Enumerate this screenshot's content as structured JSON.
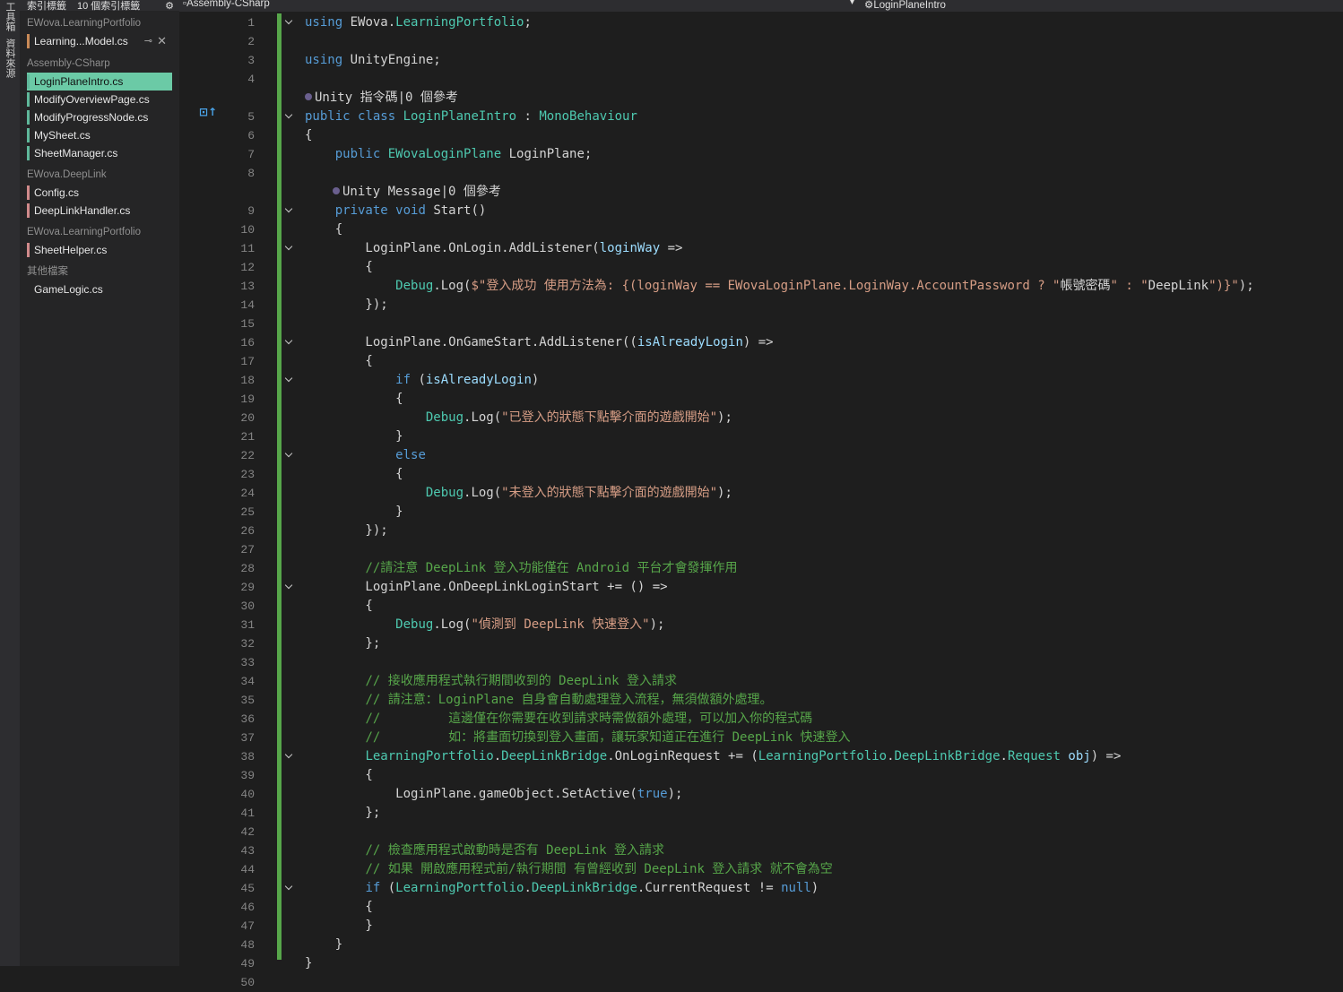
{
  "panel": {
    "header_left": "索引標籤",
    "header_count": "10 個索引標籤",
    "vertical_tabs": [
      "工具箱",
      "資料來源"
    ],
    "groups": [
      {
        "name": "EWova.LearningPortfolio",
        "color": "orange",
        "files": [
          {
            "name": "Learning...Model.cs",
            "pinned": true,
            "closable": true
          }
        ]
      },
      {
        "name": "Assembly-CSharp",
        "color": "green",
        "files": [
          {
            "name": "LoginPlaneIntro.cs",
            "selected": true
          },
          {
            "name": "ModifyOverviewPage.cs"
          },
          {
            "name": "ModifyProgressNode.cs"
          },
          {
            "name": "MySheet.cs"
          },
          {
            "name": "SheetManager.cs"
          }
        ]
      },
      {
        "name": "EWova.DeepLink",
        "color": "pink",
        "files": [
          {
            "name": "Config.cs"
          },
          {
            "name": "DeepLinkHandler.cs"
          }
        ]
      },
      {
        "name": "EWova.LearningPortfolio",
        "color": "pink",
        "files": [
          {
            "name": "SheetHelper.cs"
          }
        ]
      },
      {
        "name": "其他檔案",
        "color": "none",
        "files": [
          {
            "name": "GameLogic.cs"
          }
        ]
      }
    ]
  },
  "navbar": {
    "project": "Assembly-CSharp",
    "member": "LoginPlaneIntro"
  },
  "codelens": {
    "class_refs": "Unity 指令碼|0 個參考",
    "method_refs": "Unity Message|0 個參考"
  },
  "code_lines": [
    {
      "n": 1,
      "text": "using EWova.LearningPortfolio;",
      "fold": true
    },
    {
      "n": 2,
      "text": ""
    },
    {
      "n": 3,
      "text": "using UnityEngine;"
    },
    {
      "n": 4,
      "text": ""
    },
    {
      "n": 5,
      "text": "public class LoginPlaneIntro : MonoBehaviour",
      "fold": true,
      "lens": "class"
    },
    {
      "n": 6,
      "text": "{"
    },
    {
      "n": 7,
      "text": "    public EWovaLoginPlane LoginPlane;"
    },
    {
      "n": 8,
      "text": ""
    },
    {
      "n": 9,
      "text": "    private void Start()",
      "fold": true,
      "lens": "method"
    },
    {
      "n": 10,
      "text": "    {"
    },
    {
      "n": 11,
      "text": "        LoginPlane.OnLogin.AddListener(loginWay =>",
      "fold": true
    },
    {
      "n": 12,
      "text": "        {"
    },
    {
      "n": 13,
      "text": "            Debug.Log($\"登入成功 使用方法為: {(loginWay == EWovaLoginPlane.LoginWay.AccountPassword ? \"帳號密碼\" : \"DeepLink\")}\");"
    },
    {
      "n": 14,
      "text": "        });"
    },
    {
      "n": 15,
      "text": ""
    },
    {
      "n": 16,
      "text": "        LoginPlane.OnGameStart.AddListener((isAlreadyLogin) =>",
      "fold": true
    },
    {
      "n": 17,
      "text": "        {"
    },
    {
      "n": 18,
      "text": "            if (isAlreadyLogin)",
      "fold": true
    },
    {
      "n": 19,
      "text": "            {"
    },
    {
      "n": 20,
      "text": "                Debug.Log(\"已登入的狀態下點擊介面的遊戲開始\");"
    },
    {
      "n": 21,
      "text": "            }"
    },
    {
      "n": 22,
      "text": "            else",
      "fold": true
    },
    {
      "n": 23,
      "text": "            {"
    },
    {
      "n": 24,
      "text": "                Debug.Log(\"未登入的狀態下點擊介面的遊戲開始\");"
    },
    {
      "n": 25,
      "text": "            }"
    },
    {
      "n": 26,
      "text": "        });"
    },
    {
      "n": 27,
      "text": ""
    },
    {
      "n": 28,
      "text": "        //請注意 DeepLink 登入功能僅在 Android 平台才會發揮作用"
    },
    {
      "n": 29,
      "text": "        LoginPlane.OnDeepLinkLoginStart += () =>",
      "fold": true
    },
    {
      "n": 30,
      "text": "        {"
    },
    {
      "n": 31,
      "text": "            Debug.Log(\"偵測到 DeepLink 快速登入\");"
    },
    {
      "n": 32,
      "text": "        };"
    },
    {
      "n": 33,
      "text": ""
    },
    {
      "n": 34,
      "text": "        // 接收應用程式執行期間收到的 DeepLink 登入請求"
    },
    {
      "n": 35,
      "text": "        // 請注意：LoginPlane 自身會自動處理登入流程，無須做額外處理。"
    },
    {
      "n": 36,
      "text": "        //         這邊僅在你需要在收到請求時需做額外處理，可以加入你的程式碼"
    },
    {
      "n": 37,
      "text": "        //         如：將畫面切換到登入畫面，讓玩家知道正在進行 DeepLink 快速登入"
    },
    {
      "n": 38,
      "text": "        LearningPortfolio.DeepLinkBridge.OnLoginRequest += (LearningPortfolio.DeepLinkBridge.Request obj) =>",
      "fold": true
    },
    {
      "n": 39,
      "text": "        {"
    },
    {
      "n": 40,
      "text": "            LoginPlane.gameObject.SetActive(true);"
    },
    {
      "n": 41,
      "text": "        };"
    },
    {
      "n": 42,
      "text": ""
    },
    {
      "n": 43,
      "text": "        // 檢查應用程式啟動時是否有 DeepLink 登入請求"
    },
    {
      "n": 44,
      "text": "        // 如果 開啟應用程式前/執行期間 有曾經收到 DeepLink 登入請求 就不會為空"
    },
    {
      "n": 45,
      "text": "        if (LearningPortfolio.DeepLinkBridge.CurrentRequest != null)",
      "fold": true
    },
    {
      "n": 46,
      "text": "        {"
    },
    {
      "n": 47,
      "text": "        }"
    },
    {
      "n": 48,
      "text": "    }"
    },
    {
      "n": 49,
      "text": "}"
    },
    {
      "n": 50,
      "text": ""
    }
  ],
  "colors": {
    "keyword": "#569cd6",
    "type": "#4ec9b0",
    "string": "#d69d85",
    "comment": "#57a64a",
    "selected_tab": "#6bcaa6",
    "change_bar": "#57a64a"
  }
}
